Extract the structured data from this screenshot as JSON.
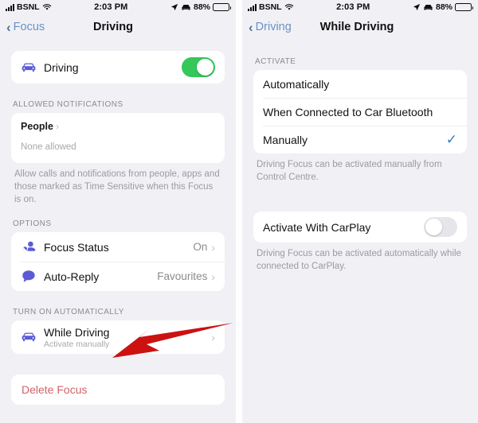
{
  "status_bar": {
    "carrier": "BSNL",
    "time": "2:03 PM",
    "battery_percent": "88%",
    "icons": [
      "signal-bars-icon",
      "wifi-icon",
      "location-arrow-icon",
      "car-focus-icon",
      "battery-icon"
    ]
  },
  "colors": {
    "accent_blue": "#6b90c6",
    "toggle_on_green": "#34c759",
    "icon_purple": "#5b5bd6",
    "destructive_red": "#d2636a",
    "checkmark_blue": "#2f7fc4",
    "arrow_red": "#cc1111",
    "page_background": "#f1f1f5",
    "card_background": "#ffffff"
  },
  "left_screen": {
    "nav": {
      "back_label": "Focus",
      "title": "Driving"
    },
    "focus_toggle_row": {
      "label": "Driving",
      "icon": "car-icon",
      "toggle_state": "on"
    },
    "allowed_notifications": {
      "header": "ALLOWED NOTIFICATIONS",
      "people_title": "People",
      "people_subtitle": "None allowed",
      "footnote": "Allow calls and notifications from people, apps and those marked as Time Sensitive when this Focus is on."
    },
    "options": {
      "header": "OPTIONS",
      "rows": [
        {
          "label": "Focus Status",
          "value": "On",
          "icon": "focus-status-icon"
        },
        {
          "label": "Auto-Reply",
          "value": "Favourites",
          "icon": "auto-reply-icon"
        }
      ]
    },
    "turn_on_automatically": {
      "header": "TURN ON AUTOMATICALLY",
      "row": {
        "label": "While Driving",
        "subtitle": "Activate manually",
        "icon": "car-icon"
      }
    },
    "delete_label": "Delete Focus"
  },
  "right_screen": {
    "nav": {
      "back_label": "Driving",
      "title": "While Driving"
    },
    "activate": {
      "header": "ACTIVATE",
      "options": [
        {
          "label": "Automatically",
          "selected": false
        },
        {
          "label": "When Connected to Car Bluetooth",
          "selected": false
        },
        {
          "label": "Manually",
          "selected": true
        }
      ],
      "footnote": "Driving Focus can be activated manually from Control Centre."
    },
    "carplay": {
      "label": "Activate With CarPlay",
      "toggle_state": "off",
      "footnote": "Driving Focus can be activated automatically while connected to CarPlay."
    }
  },
  "annotation": {
    "type": "red-arrow",
    "points_to": "While Driving"
  }
}
